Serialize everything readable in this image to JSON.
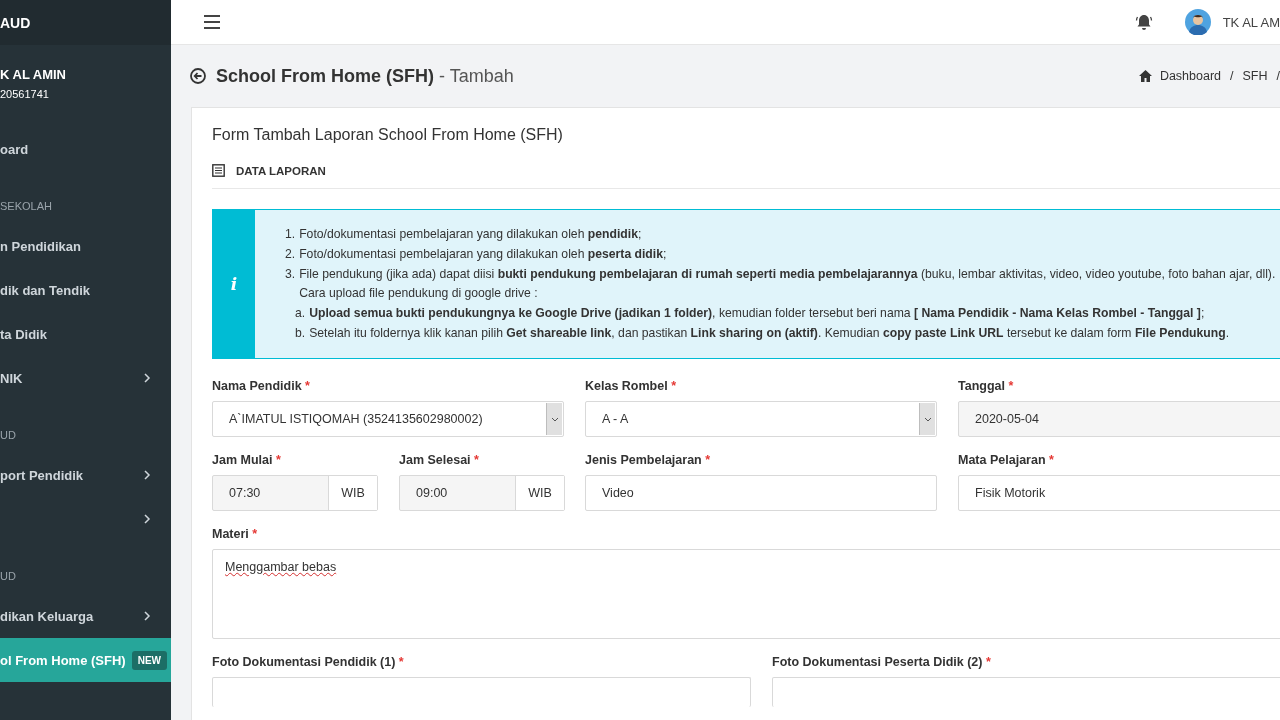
{
  "sidebar": {
    "brand": "AUD",
    "user": {
      "name": "K AL AMIN",
      "id": "20561741"
    },
    "items": [
      {
        "kind": "item",
        "label": "oard",
        "submenu": false,
        "selected": false
      },
      {
        "kind": "section",
        "label": "SEKOLAH"
      },
      {
        "kind": "item",
        "label": "n Pendidikan",
        "submenu": false,
        "selected": false
      },
      {
        "kind": "item",
        "label": "dik dan Tendik",
        "submenu": false,
        "selected": false
      },
      {
        "kind": "item",
        "label": "ta Didik",
        "submenu": false,
        "selected": false
      },
      {
        "kind": "item",
        "label": "NIK",
        "submenu": true,
        "selected": false
      },
      {
        "kind": "section",
        "label": "UD"
      },
      {
        "kind": "item",
        "label": "port Pendidik",
        "submenu": true,
        "selected": false
      },
      {
        "kind": "item",
        "submenu": true,
        "selected": false
      },
      {
        "kind": "section",
        "label": "UD"
      },
      {
        "kind": "item",
        "label": "dikan Keluarga",
        "submenu": true,
        "selected": false
      },
      {
        "kind": "item",
        "label": "ol From Home (SFH)",
        "submenu": false,
        "selected": true,
        "badge": "NEW"
      }
    ]
  },
  "topbar": {
    "user": "TK AL AM"
  },
  "page_header": {
    "title": "School From Home (SFH)",
    "subtitle": "- Tambah",
    "breadcrumb": [
      {
        "kind": "link",
        "label": "Dashboard",
        "home": true
      },
      {
        "kind": "separator",
        "label": "/"
      },
      {
        "kind": "link",
        "label": "SFH",
        "home": false
      },
      {
        "kind": "separator",
        "label": "/"
      }
    ]
  },
  "card": {
    "title": "Form Tambah Laporan School From Home (SFH)",
    "section": "DATA LAPORAN",
    "info": {
      "icon": "i",
      "items": [
        {
          "marker": "1.",
          "text": "Foto/dokumentasi pembelajaran yang dilakukan oleh **pendidik**;"
        },
        {
          "marker": "2.",
          "text": "Foto/dokumentasi pembelajaran yang dilakukan oleh **peserta didik**;"
        },
        {
          "marker": "3.",
          "text": "File pendukung (jika ada) dapat diisi **bukti pendukung pembelajaran di rumah seperti media pembelajarannya** (buku, lembar aktivitas, video, video youtube, foto bahan ajar, dll). Cara upload file pendukung di google drive :",
          "children": [
            {
              "marker": "a.",
              "text": "**Upload semua bukti pendukungnya ke Google Drive (jadikan 1 folder)**, kemudian folder tersebut beri nama **[ Nama Pendidik - Nama Kelas Rombel - Tanggal ]**;"
            },
            {
              "marker": "b.",
              "text": "Setelah itu foldernya klik kanan pilih **Get shareable link**, dan pastikan **Link sharing on (aktif)**. Kemudian **copy paste Link URL** tersebut ke dalam form **File Pendukung**."
            }
          ]
        }
      ]
    },
    "rows": [
      [
        {
          "kind": "select",
          "label": "Nama Pendidik",
          "required": "*",
          "value": "A`IMATUL ISTIQOMAH (3524135602980002)"
        },
        {
          "kind": "select",
          "label": "Kelas Rombel",
          "required": "*",
          "value": "A - A"
        },
        {
          "kind": "readonly",
          "label": "Tanggal",
          "required": "*",
          "value": "2020-05-04"
        }
      ],
      [
        {
          "kind": "pair",
          "fields": [
            {
              "kind": "addon",
              "label": "Jam Mulai",
              "required": "*",
              "value": "07:30",
              "addon": "WIB"
            },
            {
              "kind": "addon",
              "label": "Jam Selesai",
              "required": "*",
              "value": "09:00",
              "addon": "WIB"
            }
          ]
        },
        {
          "kind": "text",
          "label": "Jenis Pembelajaran",
          "required": "*",
          "value": "Video"
        },
        {
          "kind": "text",
          "label": "Mata Pelajaran",
          "required": "*",
          "value": "Fisik Motorik"
        }
      ],
      [
        {
          "kind": "textarea",
          "label": "Materi",
          "required": "*",
          "value": "Menggambar bebas"
        }
      ],
      [
        {
          "kind": "file",
          "label": "Foto Dokumentasi Pendidik (1)",
          "required": "*"
        },
        {
          "kind": "file",
          "label": "Foto Dokumentasi Peserta Didik (2)",
          "required": "*"
        }
      ]
    ]
  }
}
